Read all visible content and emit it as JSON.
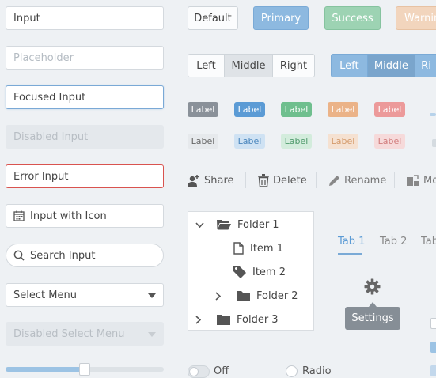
{
  "inputs": {
    "input_value": "Input",
    "placeholder": "Placeholder",
    "focused_value": "Focused Input",
    "disabled_value": "Disabled Input",
    "error_value": "Error Input",
    "icon_value": "Input with Icon",
    "search_value": "Search Input",
    "select_value": "Select Menu",
    "disabled_select_value": "Disabled Select Menu"
  },
  "slider": {
    "level": 0.5
  },
  "buttons": {
    "default": "Default",
    "primary": "Primary",
    "success": "Success",
    "warning": "Warnin"
  },
  "segmented_1": [
    "Left",
    "Middle",
    "Right"
  ],
  "segmented_2": [
    "Left",
    "Middle",
    "Ri"
  ],
  "labels": {
    "solid": [
      "Label",
      "Label",
      "Label",
      "Label",
      "Label"
    ],
    "light": [
      "Label",
      "Label",
      "Label",
      "Label",
      "Label"
    ]
  },
  "toolbar": {
    "share": "Share",
    "delete": "Delete",
    "rename": "Rename",
    "move": "Mo"
  },
  "tree": {
    "folder1": "Folder 1",
    "item1": "Item 1",
    "item2": "Item 2",
    "folder2": "Folder 2",
    "folder3": "Folder 3"
  },
  "tabs": [
    "Tab 1",
    "Tab 2",
    "Tab"
  ],
  "tooltip": "Settings",
  "toggle_label": "Off",
  "radio_label": "Radio",
  "colors": {
    "primary": "#7fb0dc",
    "success": "#8fcca8",
    "warning": "#f1d2b6",
    "danger": "#d9534f",
    "accent": "#5b9bd5"
  }
}
